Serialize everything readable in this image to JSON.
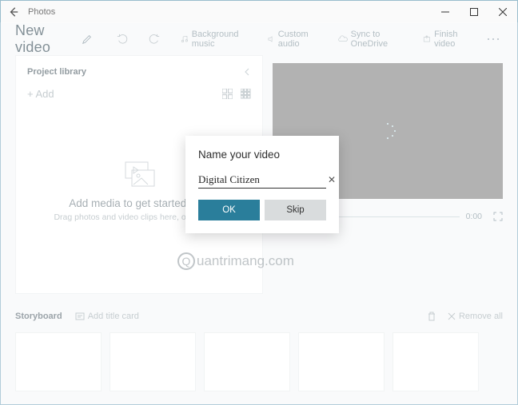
{
  "app": {
    "title": "Photos"
  },
  "header": {
    "video_title": "New video",
    "bg_music": "Background music",
    "custom_audio": "Custom audio",
    "sync": "Sync to OneDrive",
    "finish": "Finish video"
  },
  "library": {
    "title": "Project library",
    "add_label": "+ Add",
    "empty_title": "Add media to get started now",
    "empty_sub": "Drag photos and video clips here, or click Add"
  },
  "preview": {
    "duration": "0:00"
  },
  "storyboard": {
    "title": "Storyboard",
    "add_title": "Add title card",
    "remove_all": "Remove all"
  },
  "modal": {
    "title": "Name your video",
    "value": "Digital Citizen",
    "ok": "OK",
    "skip": "Skip"
  },
  "watermark": "uantrimang.com"
}
